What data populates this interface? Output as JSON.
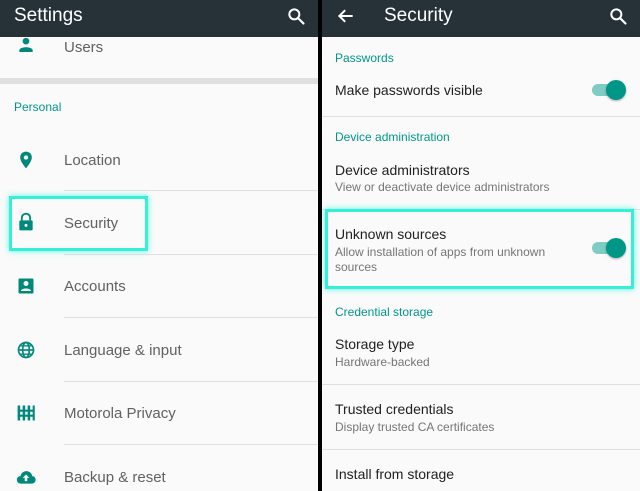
{
  "left_screen": {
    "title": "Settings",
    "icons": {
      "search": "search-icon"
    },
    "top_item": {
      "label": "Users",
      "icon": "person-icon"
    },
    "section": "Personal",
    "items": [
      {
        "label": "Location",
        "icon": "location-pin-icon"
      },
      {
        "label": "Security",
        "icon": "lock-icon"
      },
      {
        "label": "Accounts",
        "icon": "account-box-icon"
      },
      {
        "label": "Language & input",
        "icon": "globe-icon"
      },
      {
        "label": "Motorola Privacy",
        "icon": "privacy-icon"
      },
      {
        "label": "Backup & reset",
        "icon": "cloud-upload-icon"
      }
    ],
    "highlighted_item": "Security"
  },
  "right_screen": {
    "title": "Security",
    "icons": {
      "back": "back-arrow-icon",
      "search": "search-icon"
    },
    "sections": {
      "passwords": "Passwords",
      "device_admin": "Device administration",
      "credential": "Credential storage"
    },
    "make_passwords_visible": {
      "title": "Make passwords visible",
      "enabled": true
    },
    "device_administrators": {
      "title": "Device administrators",
      "summary": "View or deactivate device administrators"
    },
    "unknown_sources": {
      "title": "Unknown sources",
      "summary_line1": "Allow installation of apps from unknown",
      "summary_line2": "sources",
      "enabled": true
    },
    "storage_type": {
      "title": "Storage type",
      "summary": "Hardware-backed"
    },
    "trusted_credentials": {
      "title": "Trusted credentials",
      "summary": "Display trusted CA certificates"
    },
    "install_from_storage": {
      "title": "Install from storage"
    }
  },
  "colors": {
    "app_bar": "#263238",
    "accent": "#009688",
    "highlight": "#33f0d6"
  }
}
